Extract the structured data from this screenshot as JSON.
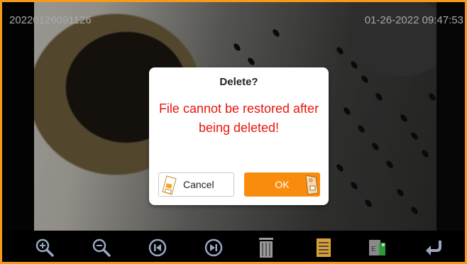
{
  "overlay": {
    "file_id": "20220126091126",
    "datetime": "01-26-2022 09:47:53"
  },
  "dialog": {
    "title": "Delete?",
    "message": "File cannot be restored after being deleted!",
    "cancel_label": "Cancel",
    "ok_label": "OK"
  },
  "toolbar": {
    "icons": [
      "zoom-in-icon",
      "zoom-out-icon",
      "previous-icon",
      "next-icon",
      "trash-icon",
      "document-icon",
      "export-icon",
      "back-icon"
    ]
  },
  "colors": {
    "frame_border": "#f59a1a",
    "accent_orange": "#f98c0c",
    "warning_red": "#e8160c",
    "toolbar_icon": "#9aa7bf"
  }
}
